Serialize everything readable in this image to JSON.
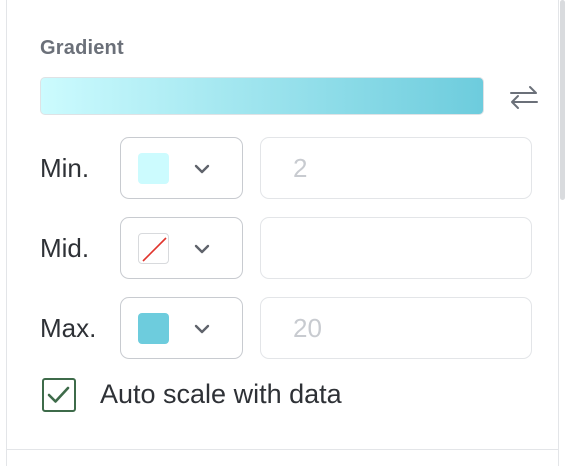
{
  "gradient": {
    "title": "Gradient",
    "start_color": "#ccfbfe",
    "end_color": "#6dccdd",
    "swap_icon": "swap-arrows-icon"
  },
  "rows": [
    {
      "label": "Min.",
      "swatch_color": "#ccfbfe",
      "swatch_type": "color",
      "value": "",
      "placeholder": "2"
    },
    {
      "label": "Mid.",
      "swatch_color": "none",
      "swatch_type": "none",
      "value": "",
      "placeholder": ""
    },
    {
      "label": "Max.",
      "swatch_color": "#6dccdd",
      "swatch_type": "color",
      "value": "",
      "placeholder": "20"
    }
  ],
  "auto_scale": {
    "label": "Auto scale with data",
    "checked": true
  },
  "colors": {
    "checkbox_accent": "#3e6b4a",
    "none_slash": "#e0342c"
  }
}
